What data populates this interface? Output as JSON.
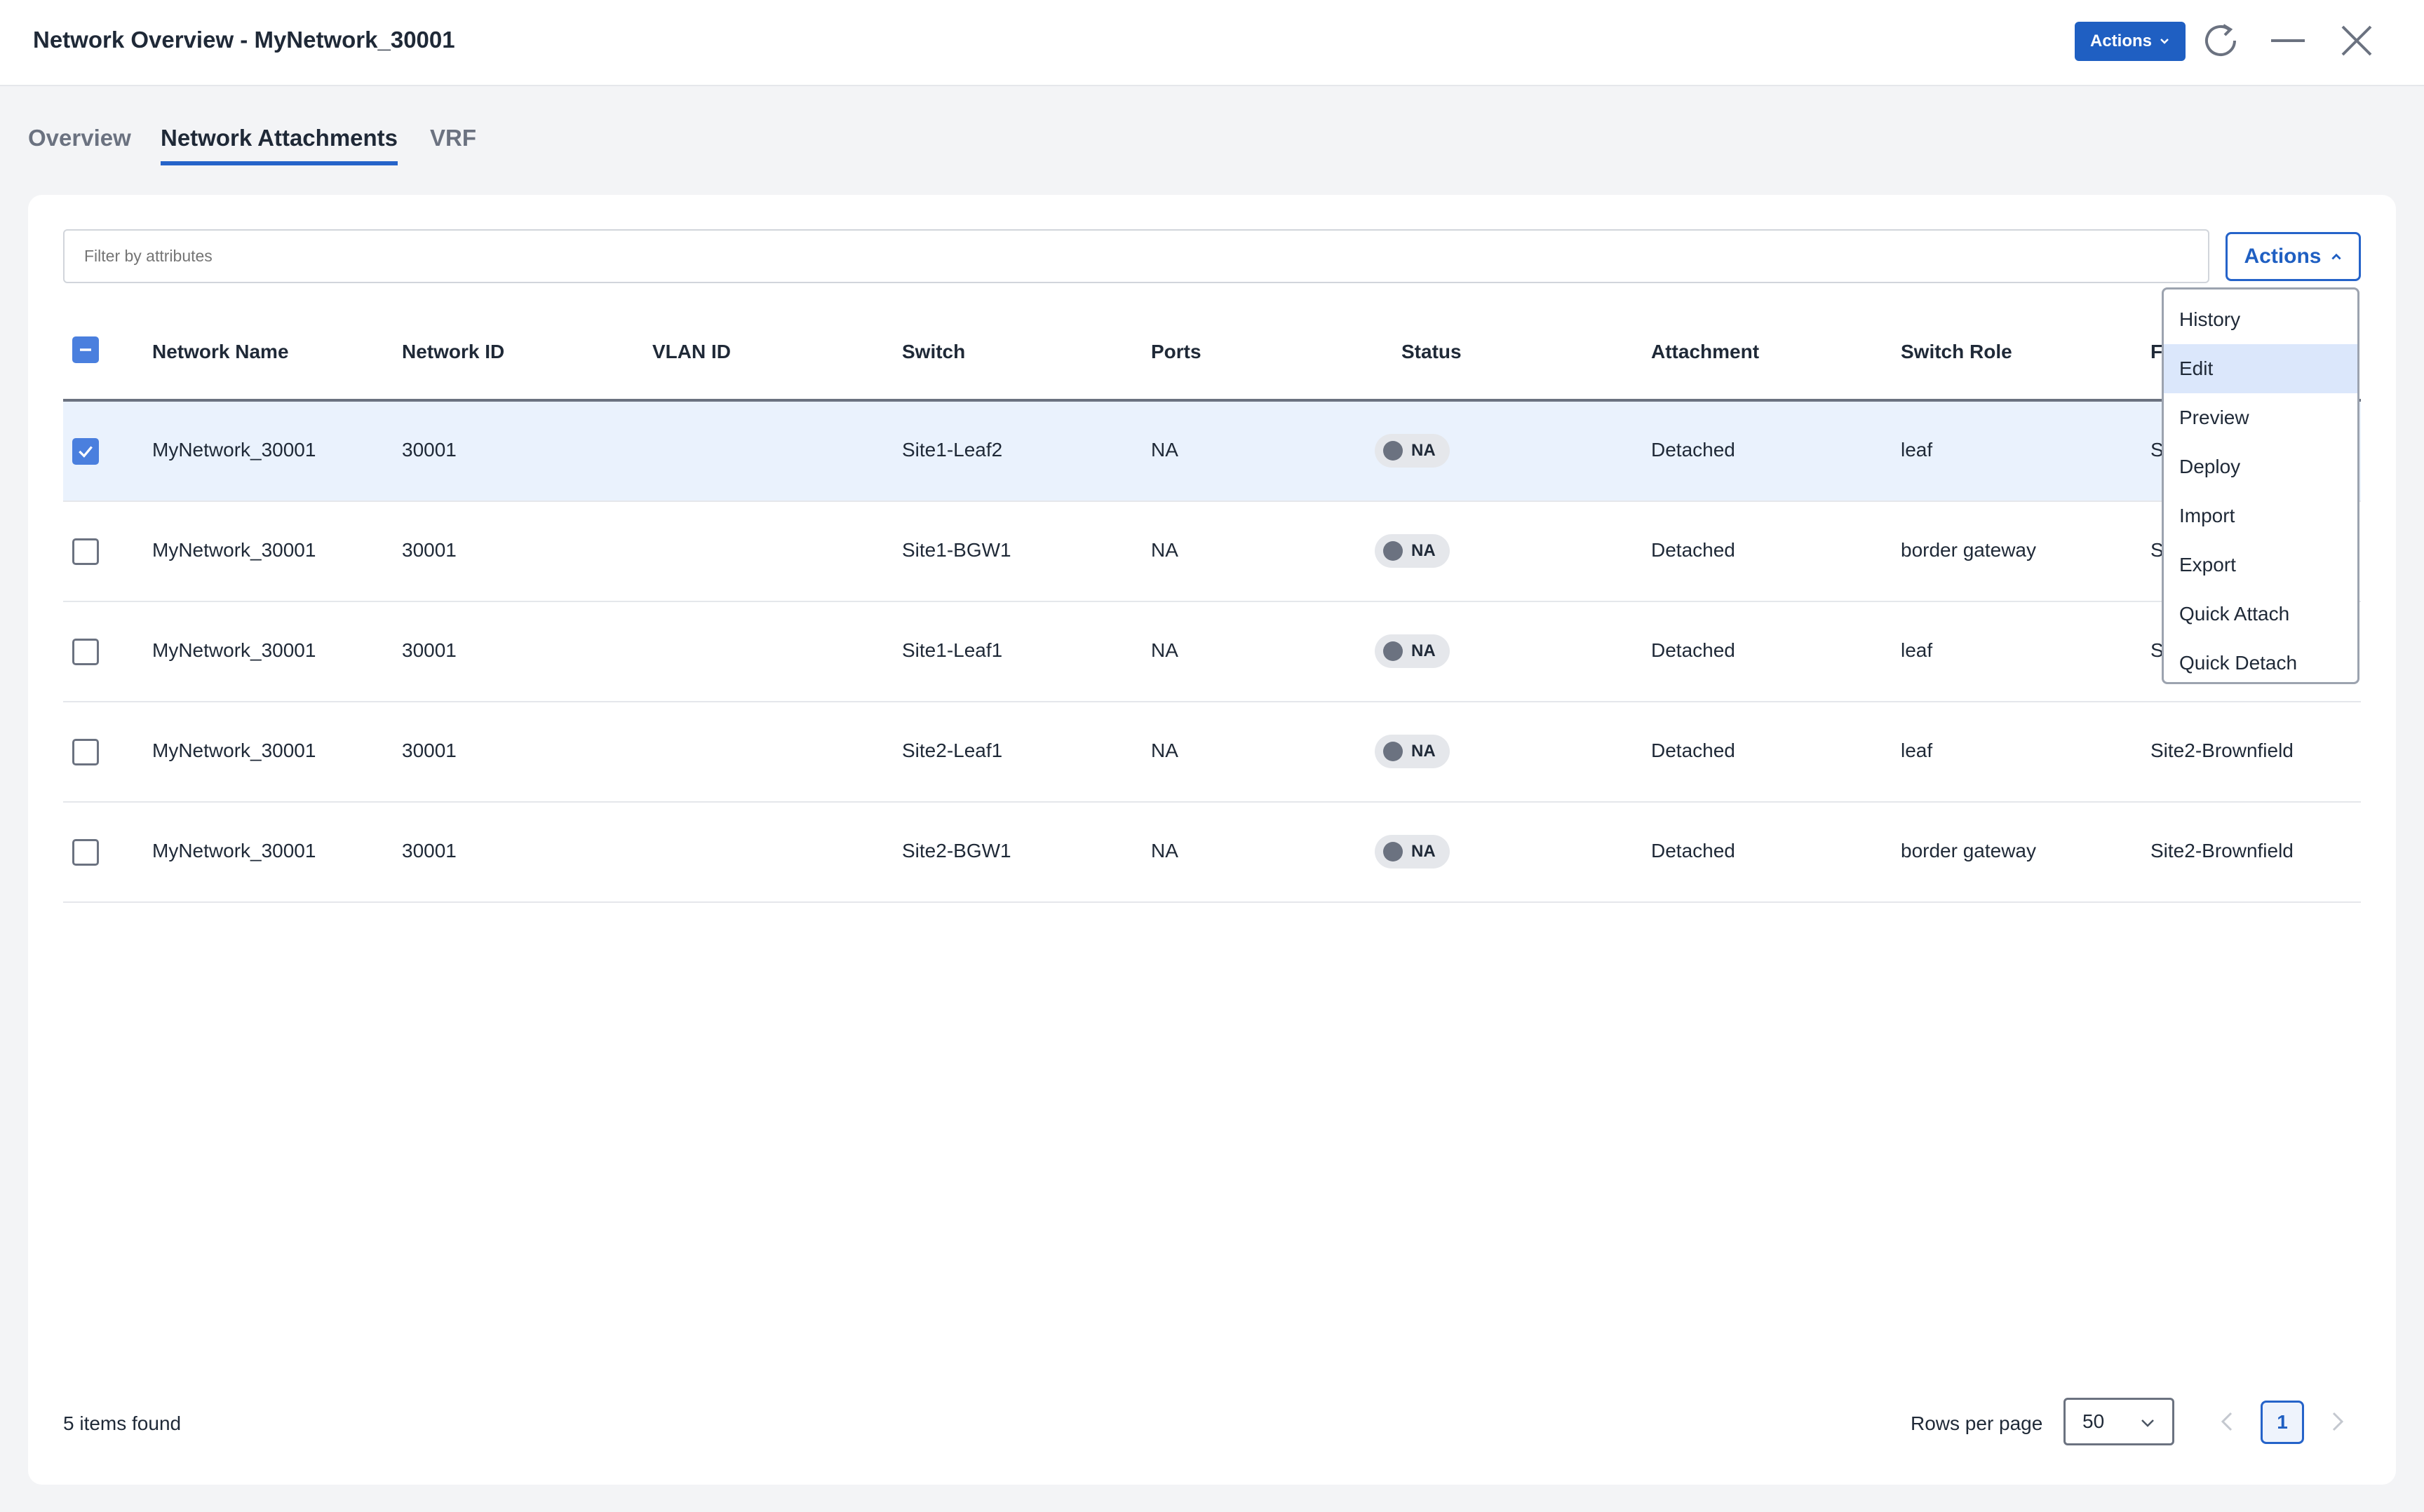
{
  "header": {
    "title": "Network Overview - MyNetwork_30001",
    "actions_label": "Actions",
    "refresh_icon": "refresh-icon",
    "minimize_icon": "minimize-icon",
    "close_icon": "close-icon"
  },
  "tabs": [
    {
      "label": "Overview",
      "active": false
    },
    {
      "label": "Network Attachments",
      "active": true
    },
    {
      "label": "VRF",
      "active": false
    }
  ],
  "filter": {
    "placeholder": "Filter by attributes"
  },
  "card_actions": {
    "label": "Actions",
    "expanded": true
  },
  "table": {
    "columns": [
      "Network Name",
      "Network ID",
      "VLAN ID",
      "Switch",
      "Ports",
      "Status",
      "Attachment",
      "Switch Role",
      "Fabric"
    ],
    "rows": [
      {
        "selected": true,
        "network_name": "MyNetwork_30001",
        "network_id": "30001",
        "vlan_id": "",
        "switch": "Site1-Leaf2",
        "ports": "NA",
        "status": "NA",
        "attachment": "Detached",
        "switch_role": "leaf",
        "fabric": "Site1"
      },
      {
        "selected": false,
        "network_name": "MyNetwork_30001",
        "network_id": "30001",
        "vlan_id": "",
        "switch": "Site1-BGW1",
        "ports": "NA",
        "status": "NA",
        "attachment": "Detached",
        "switch_role": "border gateway",
        "fabric": "Site1"
      },
      {
        "selected": false,
        "network_name": "MyNetwork_30001",
        "network_id": "30001",
        "vlan_id": "",
        "switch": "Site1-Leaf1",
        "ports": "NA",
        "status": "NA",
        "attachment": "Detached",
        "switch_role": "leaf",
        "fabric": "Site1"
      },
      {
        "selected": false,
        "network_name": "MyNetwork_30001",
        "network_id": "30001",
        "vlan_id": "",
        "switch": "Site2-Leaf1",
        "ports": "NA",
        "status": "NA",
        "attachment": "Detached",
        "switch_role": "leaf",
        "fabric": "Site2-Brownfield"
      },
      {
        "selected": false,
        "network_name": "MyNetwork_30001",
        "network_id": "30001",
        "vlan_id": "",
        "switch": "Site2-BGW1",
        "ports": "NA",
        "status": "NA",
        "attachment": "Detached",
        "switch_role": "border gateway",
        "fabric": "Site2-Brownfield"
      }
    ]
  },
  "actions_menu": {
    "items": [
      "History",
      "Edit",
      "Preview",
      "Deploy",
      "Import",
      "Export",
      "Quick Attach",
      "Quick Detach"
    ],
    "highlighted": "Edit"
  },
  "footer": {
    "items_found": "5 items found",
    "rows_per_page_label": "Rows per page",
    "rows_per_page_value": "50",
    "current_page": "1"
  },
  "colors": {
    "primary": "#1f5fc2",
    "selected_row": "#eaf2fd",
    "menu_highlight": "#dbe7fb",
    "status_dot": "#6b7280"
  }
}
